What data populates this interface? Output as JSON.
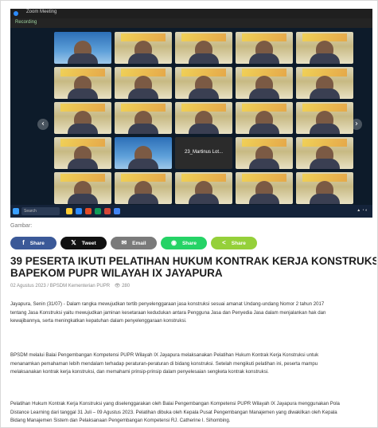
{
  "zoom": {
    "window_title": "Zoom Meeting",
    "recording_label": "Recording",
    "center_tile_name": "23_Martinus Lot...",
    "taskbar_search": "Search"
  },
  "caption": "Gambar:",
  "share": [
    {
      "label": "Share",
      "icon": "facebook-icon",
      "color": "#3b5998",
      "glyph": "f"
    },
    {
      "label": "Tweet",
      "icon": "x-icon",
      "color": "#111111",
      "glyph": "𝕏"
    },
    {
      "label": "Email",
      "icon": "email-icon",
      "color": "#7a7a7a",
      "glyph": "✉"
    },
    {
      "label": "Share",
      "icon": "whatsapp-icon",
      "color": "#25d366",
      "glyph": "◉"
    },
    {
      "label": "Share",
      "icon": "sharethis-icon",
      "color": "#95d03a",
      "glyph": "<"
    }
  ],
  "article": {
    "title_line1": "39 PESERTA IKUTI PELATIHAN HUKUM KONTRAK KERJA KONSTRUKSI DI",
    "title_line2": "BAPEKOM PUPR WILAYAH IX JAYAPURA",
    "date": "02 Agustus 2023",
    "author": "BPSDM Kementerian PUPR",
    "views": "280",
    "p1_line1": "Jayapura, Senin (31/07) - Dalam rangka mewujudkan tertib penyelenggaraan jasa konstruksi sesuai amanat Undang-undang Nomor 2 tahun 2017",
    "p1_line2": "tentang Jasa Konstruksi yaitu mewujudkan jaminan kesetaraan kedudukan antara Pengguna Jasa dan Penyedia Jasa dalam menjalankan hak dan",
    "p1_line3": "kewajibannya, serta meningkatkan kepatuhan dalam penyelenggaraan konstruksi.",
    "p2_line1": "BPSDM melalui Balai Pengembangan Kompetensi PUPR Wilayah IX Jayapura melaksanakan Pelatihan Hukum Kontrak Kerja Konstruksi untuk",
    "p2_line2": "menanamkan pemahaman lebih mendalam terhadap peraturan-peraturan di bidang konstruksi. Setelah mengikuti pelatihan ini, peserta mampu",
    "p2_line3": "melaksanakan kontrak kerja konstruksi, dan memahami prinsip-prinsip dalam penyelesaian sengketa kontrak konstruksi.",
    "p3_line1": "Pelatihan Hukum Kontrak Kerja Konstruksi yang diselenggarakan oleh Balai Pengembangan Kompetensi PUPR Wilayah IX Jayapura menggunakan Pola",
    "p3_line2": "Distance Learning dari tanggal 31 Juli – 09 Agustus 2023. Pelatihan dibuka oleh Kepala Pusat Pengembangan Manajemen yang diwakilkan oleh Kepala",
    "p3_line3": "Bidang Manajemen Sistem dan Pelaksanaan Pengembangan Kompetensi RJ. Catherine I. Sihombing."
  }
}
